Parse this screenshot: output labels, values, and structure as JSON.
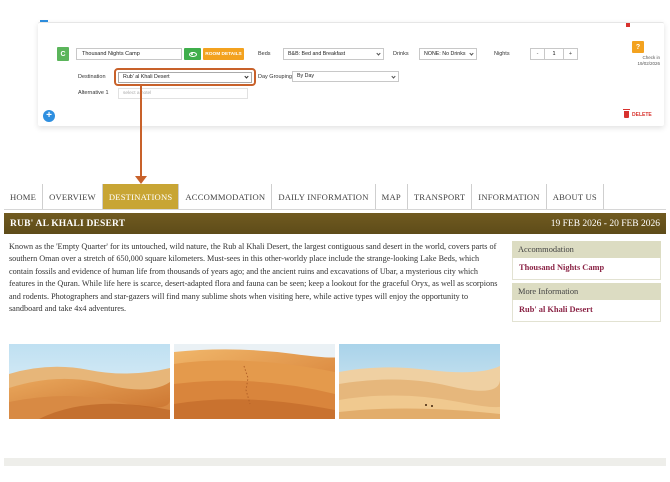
{
  "editor": {
    "badge": "C",
    "hotel_name": "Thousand Nights Camp",
    "room_details_label": "ROOM DETAILS",
    "beds_label": "Beds",
    "beds_value": "B&B: Bed and Breakfast",
    "drinks_label": "Drinks",
    "drinks_value": "NONE: No Drinks",
    "nights_label": "Nights",
    "nights_minus": "-",
    "nights_value": "1",
    "nights_plus": "+",
    "help_label": "?",
    "checkin_label": "Check in",
    "checkin_date": "19/02/2026",
    "destination_label": "Destination",
    "destination_value": "Rub' al Khali Desert",
    "day_grouping_label": "Day Grouping",
    "day_grouping_value": "By Day",
    "alternative_label": "Alternative 1",
    "alternative_placeholder": "select a hotel",
    "add_label": "+",
    "delete_label": "DELETE"
  },
  "nav": {
    "tabs": [
      "HOME",
      "OVERVIEW",
      "DESTINATIONS",
      "ACCOMMODATION",
      "DAILY INFORMATION",
      "MAP",
      "TRANSPORT",
      "INFORMATION",
      "ABOUT US"
    ],
    "active_index": 2
  },
  "page": {
    "title": "RUB' AL KHALI DESERT",
    "dates": "19 FEB 2026 - 20 FEB 2026",
    "description": "Known as the 'Empty Quarter' for its untouched, wild nature, the Rub al Khali Desert, the largest contiguous sand desert in the world, covers parts of southern Oman over a stretch of 650,000 square kilometers. Must-sees in this other-worldy place include the strange-looking Lake Beds, which contain fossils and evidence of human life from thousands of years ago; and the ancient ruins and excavations of Ubar, a mysterious city which features in the Quran. While life here is scarce, desert-adapted flora and fauna can be seen; keep a lookout for the graceful Oryx, as well as scorpions and rodents. Photographers and star-gazers will find many sublime shots when visiting here, while active types will enjoy the opportunity to sandboard and take 4x4 adventures."
  },
  "sidebar": {
    "accommodation_heading": "Accommodation",
    "accommodation_link": "Thousand Nights Camp",
    "more_info_heading": "More Information",
    "more_info_link": "Rub' al Khali Desert"
  },
  "colors": {
    "accent_gold": "#c8a534",
    "title_bar": "#6b571f",
    "link_maroon": "#8b2446",
    "highlight": "#c8612a"
  }
}
